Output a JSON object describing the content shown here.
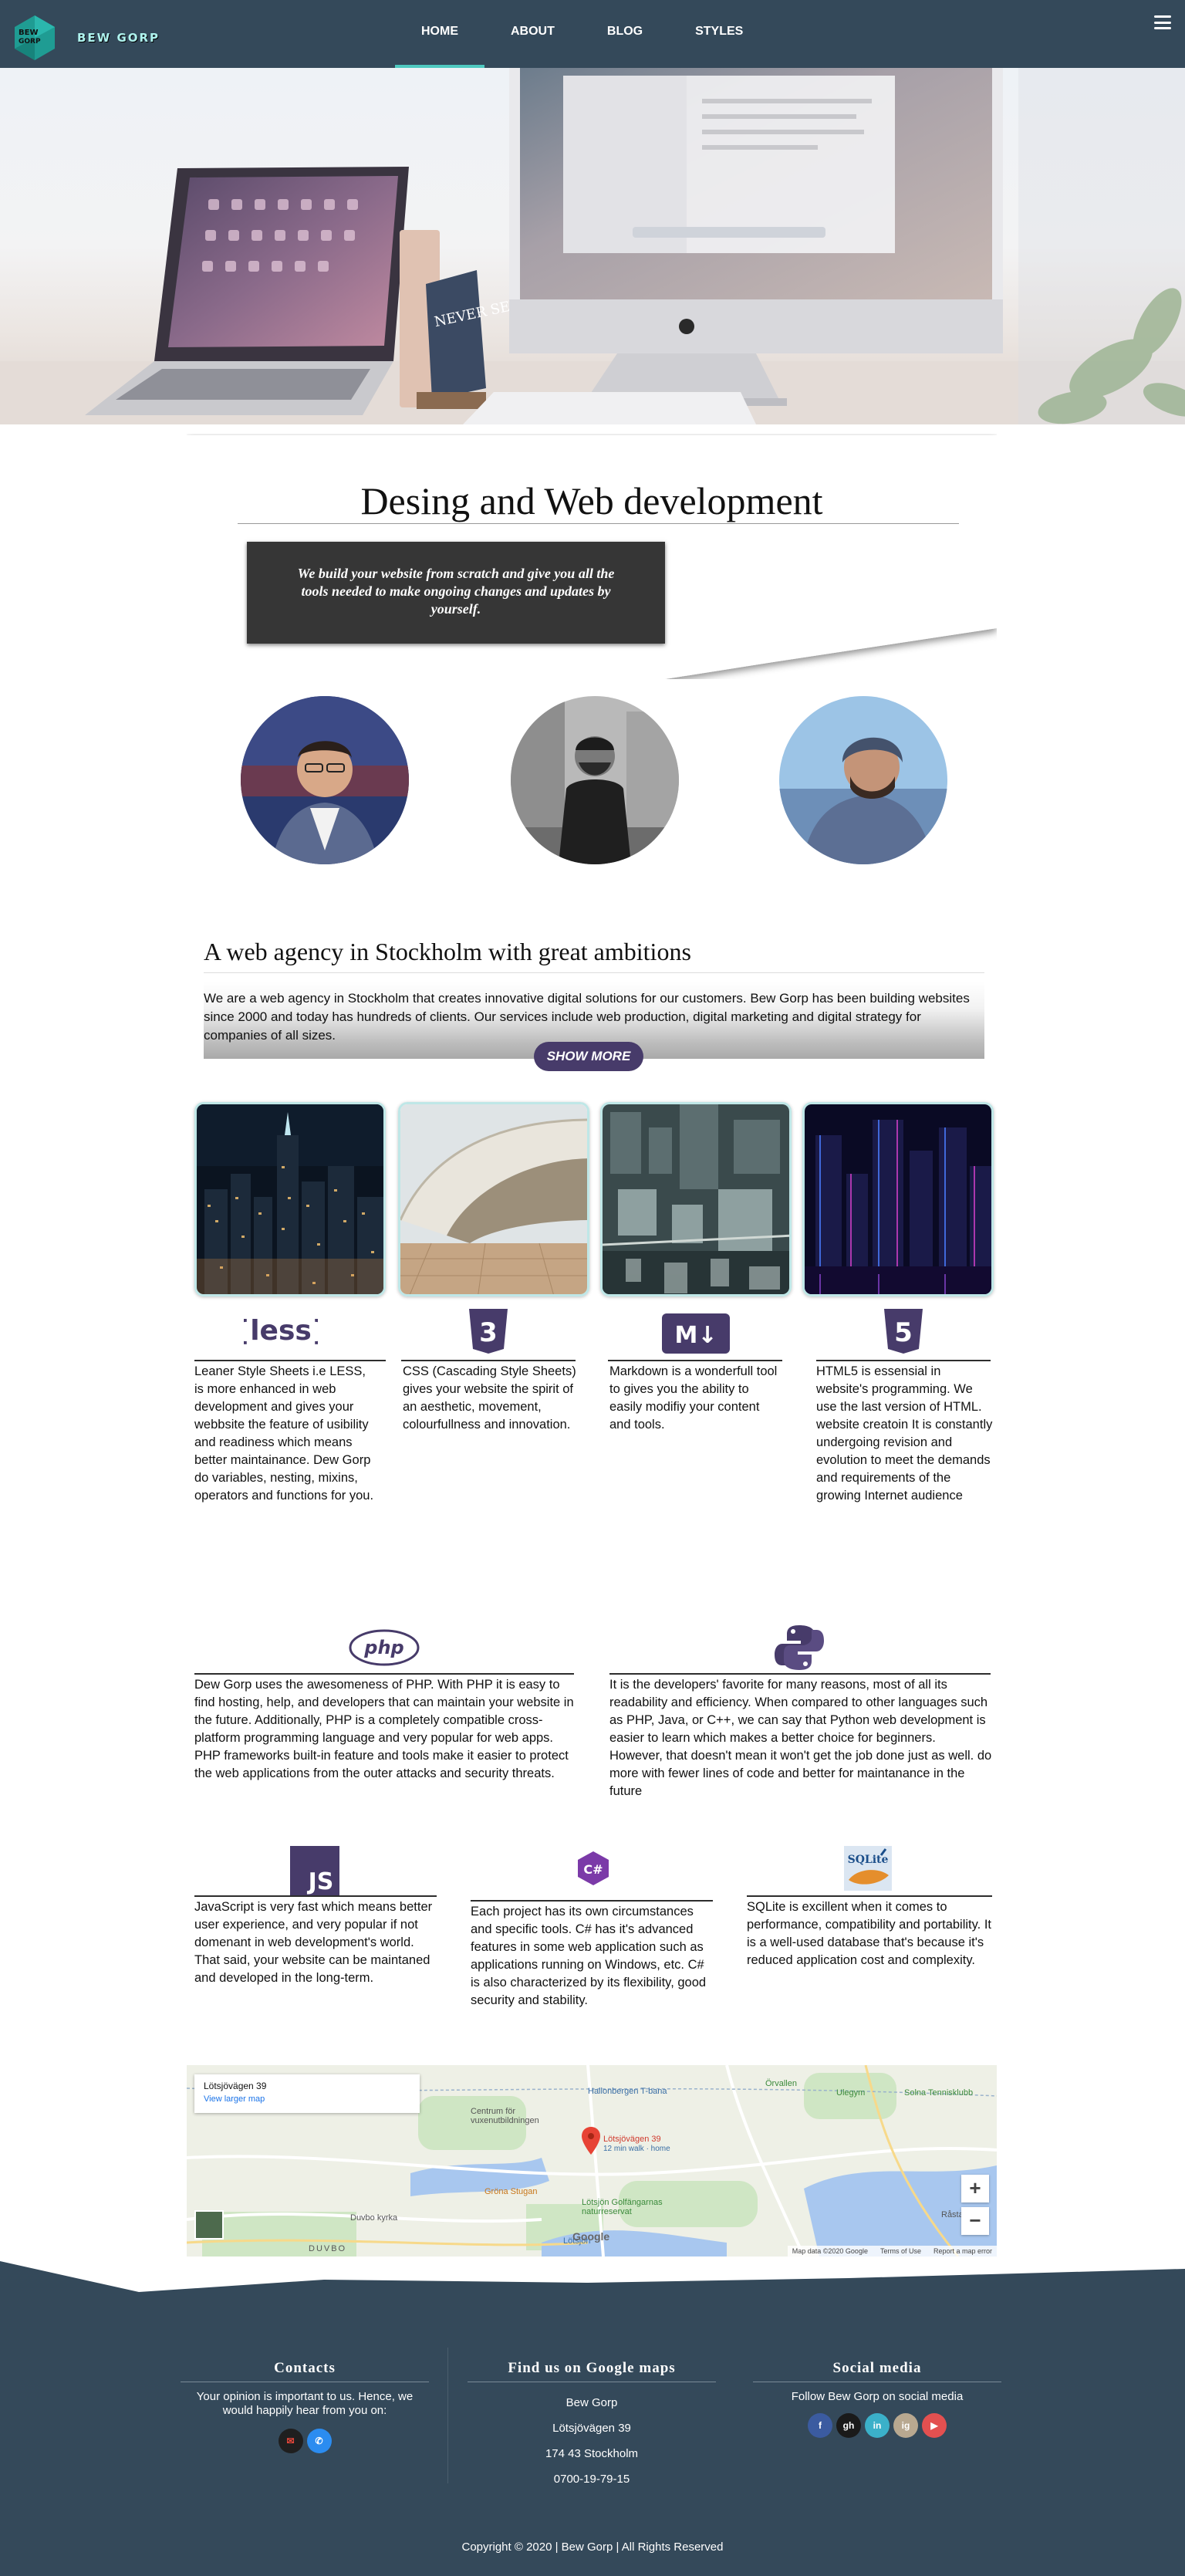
{
  "brand": {
    "name": "BEW GORP",
    "logo_text": "BEW GORP"
  },
  "nav": {
    "items": [
      {
        "label": "HOME",
        "active": true
      },
      {
        "label": "ABOUT",
        "active": false
      },
      {
        "label": "BLOG",
        "active": false
      },
      {
        "label": "STYLES",
        "active": false
      }
    ],
    "menu_icon": "hamburger-menu-icon"
  },
  "hero": {
    "image": "desk-with-laptop-and-imac",
    "card_text": "NEVER SETTLE"
  },
  "intro": {
    "title": "Desing and Web development",
    "tagline": "We build your website from scratch and give you all the tools needed to make ongoing changes and updates by yourself."
  },
  "team": {
    "avatars": [
      "team-member-1",
      "team-member-2",
      "team-member-3"
    ]
  },
  "agency": {
    "title": "A web agency in Stockholm with great ambitions",
    "text": "We are a web agency in Stockholm that creates innovative digital solutions for our customers. Bew Gorp has been building websites since 2000 and today has hundreds of clients. Our services include web production, digital marketing and digital strategy for companies of all sizes.",
    "show_more": "SHOW MORE"
  },
  "gallery": [
    "city-night-skyline",
    "opera-house-roof",
    "aerial-city-towers",
    "neon-skyscrapers-night"
  ],
  "tech_row1": [
    {
      "icon": "less-icon",
      "icon_text": "{less}",
      "text": "Leaner Style Sheets i.e LESS, is more enhanced in web development and gives your webbsite the feature of usibility and readiness which means better maintainance. Dew Gorp do variables, nesting, mixins, operators and functions for you."
    },
    {
      "icon": "css3-icon",
      "icon_text": "3",
      "text": "CSS (Cascading Style Sheets) gives your website the spirit of an aesthetic, movement, colourfullness and innovation."
    },
    {
      "icon": "markdown-icon",
      "icon_text": "M↓",
      "text": "Markdown is a wonderfull tool to gives you the ability to easily modifiy your content and tools."
    },
    {
      "icon": "html5-icon",
      "icon_text": "5",
      "text": "HTML5 is essensial in website's programming. We use the last version of HTML. website creatoin It is constantly undergoing revision and evolution to meet the demands and requirements of the growing Internet audience"
    }
  ],
  "tech_row2": [
    {
      "icon": "php-icon",
      "icon_text": "php",
      "text": "Dew Gorp uses the awesomeness of PHP. With PHP it is easy to find hosting, help, and developers that can maintain your website in the future. Additionally, PHP is a completely compatible cross-platform programming language and very popular for web apps. PHP frameworks built-in feature and tools make it easier to protect the web applications from the outer attacks and security threats."
    },
    {
      "icon": "python-icon",
      "icon_text": "",
      "text": "It is the developers' favorite for many reasons, most of all its readability and efficiency. When compared to other languages such as PHP, Java, or C++, we can say that Python web development is easier to learn which makes a better choice for beginners. However, that doesn't mean it won't get the job done just as well. do more with fewer lines of code and better for maintanance in the future"
    }
  ],
  "tech_row3": [
    {
      "icon": "javascript-icon",
      "icon_text": "JS",
      "text": "JavaScript is very fast which means better user experience, and very popular if not domenant in web development's world. That said, your website can be maintaned and developed in the long-term."
    },
    {
      "icon": "csharp-icon",
      "icon_text": "C#",
      "text": "Each project has its own circumstances and specific tools. C# has it's advanced features in some web application such as applications running on Windows, etc. C# is also characterized by its flexibility, good security and stability."
    },
    {
      "icon": "sqlite-icon",
      "icon_text": "SQLite",
      "text": "SQLite is excillent when it comes to performance, compatibility and portability. It is a well-used database that's because it's reduced application cost and complexity."
    }
  ],
  "map": {
    "place": "Lötsjövägen 39",
    "view_larger": "View larger map",
    "marker_label": "Lötsjövägen 39",
    "marker_sub": "12 min walk · home",
    "labels": [
      "Hallonbergen T-bana",
      "Centrum för vuxenutbildningen",
      "Gröna Stugan",
      "Lötsjön Golfängarnas naturreservat",
      "Lötsjön",
      "Duvbo kyrka",
      "DUVBO",
      "Örvallen",
      "Ulegym",
      "Solna Tennisklubb",
      "Råstasjön"
    ],
    "footer": [
      "Map data ©2020 Google",
      "Terms of Use",
      "Report a map error"
    ],
    "google": "Google",
    "zoom_in": "+",
    "zoom_out": "−"
  },
  "footer": {
    "contacts": {
      "title": "Contacts",
      "text": "Your opinion is important to us. Hence, we would happily hear from you on:"
    },
    "google_maps": {
      "title": "Find us on Google maps",
      "lines": [
        "Bew Gorp",
        "Lötsjövägen 39",
        "174 43 Stockholm",
        "0700-19-79-15"
      ]
    },
    "social": {
      "title": "Social media",
      "text": "Follow Bew Gorp on social media",
      "buttons": [
        "f",
        "gh",
        "in",
        "ig",
        "▶"
      ]
    },
    "copyright": "Copyright © 2020 | Bew Gorp | All Rights Reserved"
  },
  "colors": {
    "nav": "#34495a",
    "accent": "#4ec9c0",
    "purple": "#473b6a",
    "footer": "#34495a"
  }
}
